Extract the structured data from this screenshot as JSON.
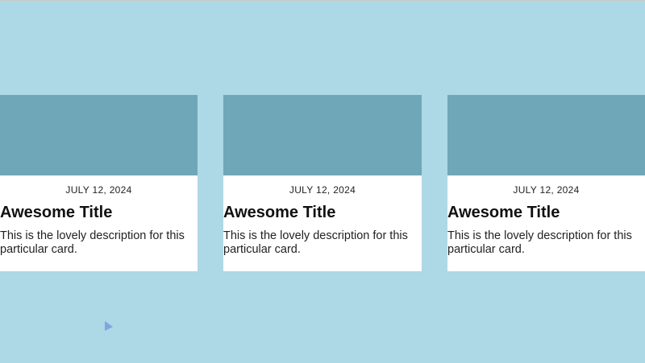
{
  "colors": {
    "page_background": "#add8e6",
    "card_image": "#6fa7b8",
    "card_background": "#ffffff",
    "cursor": "#7ea6e0"
  },
  "cards": [
    {
      "date": "JULY 12, 2024",
      "title": "Awesome Title",
      "description": "This is the lovely description for this particular card."
    },
    {
      "date": "JULY 12, 2024",
      "title": "Awesome Title",
      "description": "This is the lovely description for this particular card."
    },
    {
      "date": "JULY 12, 2024",
      "title": "Awesome Title",
      "description": "This is the lovely description for this particular card."
    }
  ],
  "cursor": {
    "icon": "pointer-arrow-icon"
  }
}
